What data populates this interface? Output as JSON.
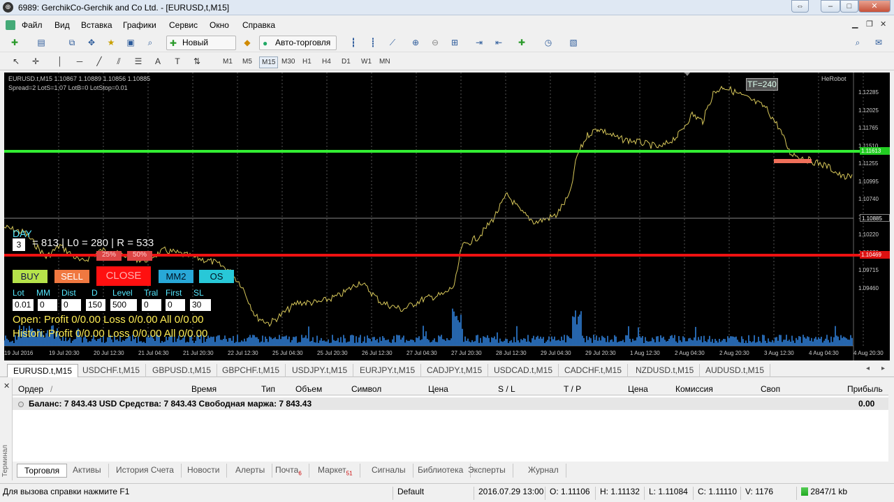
{
  "window": {
    "title": "6989: GerchikCo-Gerchik and Co Ltd. - [EURUSD,t,M15]",
    "icon": "terminal-app-icon"
  },
  "menu": [
    "Файл",
    "Вид",
    "Вставка",
    "Графики",
    "Сервис",
    "Окно",
    "Справка"
  ],
  "toolbar": {
    "new_order": "Новый ордер",
    "auto_trading": "Авто-торговля",
    "timeframes": [
      "M1",
      "M5",
      "M15",
      "M30",
      "H1",
      "H4",
      "D1",
      "W1",
      "MN"
    ],
    "selected_timeframe": "M15"
  },
  "chart": {
    "header_line1": "EURUSD.t,M15  1.10867 1.10889 1.10856 1.10885",
    "header_line2": "Spread=2  LotS=1.07  LotB=0  LotStop=0.01",
    "brand": "HeRobot",
    "tf_badge": "TF=240",
    "price_labels": [
      "1.12285",
      "1.12025",
      "1.11765",
      "1.11510",
      "1.11255",
      "1.10995",
      "1.10740",
      "1.10480",
      "1.10220",
      "1.09970",
      "1.09715",
      "1.09460"
    ],
    "green_level": "1.11613",
    "red_level": "1.10469",
    "current_price": "1.10885",
    "time_labels": [
      "19 Jul 2016",
      "19 Jul 20:30",
      "20 Jul 12:30",
      "21 Jul 04:30",
      "21 Jul 20:30",
      "22 Jul 12:30",
      "25 Jul 04:30",
      "25 Jul 20:30",
      "26 Jul 12:30",
      "27 Jul 04:30",
      "27 Jul 20:30",
      "28 Jul 12:30",
      "29 Jul 04:30",
      "29 Jul 20:30",
      "1 Aug 12:30",
      "2 Aug 04:30",
      "2 Aug 20:30",
      "3 Aug 12:30",
      "4 Aug 04:30",
      "4 Aug 20:30"
    ],
    "colors": {
      "bg": "#000000",
      "green_line": "#33ee33",
      "red_line": "#ee1111",
      "price": "#d8c85a",
      "volume": "#2f7fd8"
    }
  },
  "panel": {
    "day_label": "DAY",
    "day_value": "3",
    "equation": "= 813 | L0 = 280 | R = 533",
    "pct_a": "25%",
    "pct_b": "50%",
    "buy": "BUY",
    "sell": "SELL",
    "close": "CLOSE",
    "mm2": "MM2",
    "os": "OS",
    "fields": [
      {
        "label": "Lot",
        "value": "0.01"
      },
      {
        "label": "MM",
        "value": "0"
      },
      {
        "label": "Dist",
        "value": "0"
      },
      {
        "label": "D",
        "value": "150"
      },
      {
        "label": "Level",
        "value": "500"
      },
      {
        "label": "Tral",
        "value": "0"
      },
      {
        "label": "First",
        "value": "0"
      },
      {
        "label": "SL",
        "value": "30"
      }
    ],
    "open_line": "Open:  Profit 0/0.00   Loss 0/0.00   All 0/0.00",
    "history_line": "Histori: Profit 0/0.00   Loss 0/0.00   All 0/0.00"
  },
  "symbol_tabs": [
    "EURUSD.t,M15",
    "USDCHF.t,M15",
    "GBPUSD.t,M15",
    "GBPCHF.t,M15",
    "USDJPY.t,M15",
    "EURJPY.t,M15",
    "CADJPY.t,M15",
    "USDCAD.t,M15",
    "CADCHF.t,M15",
    "NZDUSD.t,M15",
    "AUDUSD.t,M15"
  ],
  "terminal": {
    "side_label": "Терминал",
    "columns": [
      "Ордер",
      "/",
      "Время",
      "Тип",
      "Объем",
      "Символ",
      "Цена",
      "S / L",
      "T / P",
      "Цена",
      "Комиссия",
      "Своп",
      "Прибыль"
    ],
    "balance_text": "Баланс: 7 843.43 USD  Средства: 7 843.43  Свободная маржа: 7 843.43",
    "balance_profit": "0.00",
    "tabs": [
      {
        "label": "Торговля",
        "badge": ""
      },
      {
        "label": "Активы",
        "badge": ""
      },
      {
        "label": "История Счета",
        "badge": ""
      },
      {
        "label": "Новости",
        "badge": ""
      },
      {
        "label": "Алерты",
        "badge": ""
      },
      {
        "label": "Почта",
        "badge": "6"
      },
      {
        "label": "Маркет",
        "badge": "51"
      },
      {
        "label": "Сигналы",
        "badge": ""
      },
      {
        "label": "Библиотека",
        "badge": ""
      },
      {
        "label": "Эксперты",
        "badge": ""
      },
      {
        "label": "Журнал",
        "badge": ""
      }
    ]
  },
  "status": {
    "help": "Для вызова справки нажмите F1",
    "profile": "Default",
    "datetime": "2016.07.29 13:00",
    "open": "O: 1.11106",
    "high": "H: 1.11132",
    "low": "L: 1.11084",
    "close": "C: 1.11110",
    "volume": "V: 1176",
    "traffic": "2847/1 kb"
  }
}
